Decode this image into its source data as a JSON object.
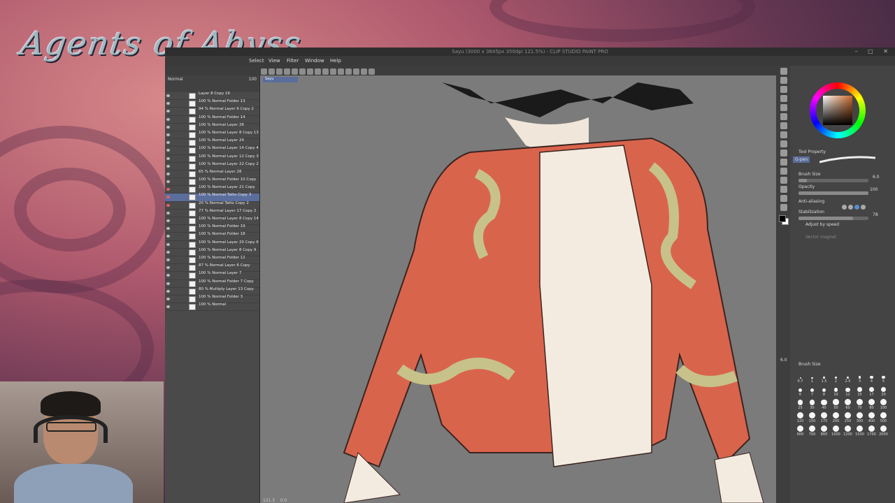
{
  "logo": {
    "text": "Agents of Abyss"
  },
  "window": {
    "title": "Sayu (3000 x 3845px 350dpi 121.5%) - CLIP STUDIO PAINT PRO",
    "controls": "– □ ✕"
  },
  "menu": [
    "Select",
    "View",
    "Filter",
    "Window",
    "Help"
  ],
  "layer_panel": {
    "header_blend": "Normal",
    "header_opacity": "100",
    "layers": [
      "Layer 8 Copy 16",
      "100 % Normal Folder 13",
      "94 % Normal Layer 6 Copy 2",
      "100 % Normal Folder 14",
      "100 % Normal Layer 26",
      "100 % Normal Layer 8 Copy 13",
      "100 % Normal Layer 24",
      "100 % Normal Layer 14 Copy 4",
      "100 % Normal Layer 12 Copy 3",
      "100 % Normal Layer 22 Copy 2",
      "65 % Normal Layer 28",
      "100 % Normal Folder 10 Copy",
      "100 % Normal Layer 21 Copy",
      "100 % Normal Tatto Copy 3",
      "20 % Normal Tatto Copy 2",
      "77 % Normal Layer 17 Copy 2",
      "100 % Normal Layer 8 Copy 14",
      "100 % Normal Folder 19",
      "100 % Normal Folder 18",
      "100 % Normal Layer 20 Copy 6",
      "100 % Normal Layer 8 Copy 9",
      "100 % Normal Folder 12",
      "87 % Normal Layer 6 Copy",
      "100 % Normal Layer 7",
      "100 % Normal Folder 7 Copy",
      "80 % Multiply Layer 13 Copy",
      "100 % Normal Folder 3",
      "100 % Normal"
    ],
    "selected_index": 13
  },
  "canvas": {
    "tab": "Sayu",
    "zoom": "121.5",
    "angle": "0.0"
  },
  "tool_property": {
    "title": "Tool Property",
    "subtool": "G-pen",
    "brush_size_label": "Brush Size",
    "brush_size_value": "6.0",
    "opacity_label": "Opacity",
    "opacity_value": "100",
    "anti_aliasing_label": "Anti-aliasing",
    "stabilization_label": "Stabilization",
    "stabilization_value": "78",
    "adjust_by_speed_label": "Adjust by speed",
    "vector_magnet_label": "Vector magnet"
  },
  "brush_size_panel": {
    "title": "Brush Size",
    "current": "6.0",
    "sizes": [
      "0.7",
      "1",
      "1.5",
      "2",
      "2.5",
      "3",
      "4",
      "5",
      "6",
      "7",
      "8",
      "10",
      "12",
      "15",
      "17",
      "20",
      "25",
      "30",
      "40",
      "50",
      "60",
      "70",
      "80",
      "100",
      "120",
      "150",
      "170",
      "200",
      "250",
      "300",
      "400",
      "500",
      "600",
      "700",
      "800",
      "1000",
      "1200",
      "1500",
      "1700",
      "2000"
    ]
  },
  "colors": {
    "main": "#000000",
    "sub": "#ffffff",
    "selected_layer": "#5b6d9c",
    "accent_red": "#e5636a"
  }
}
